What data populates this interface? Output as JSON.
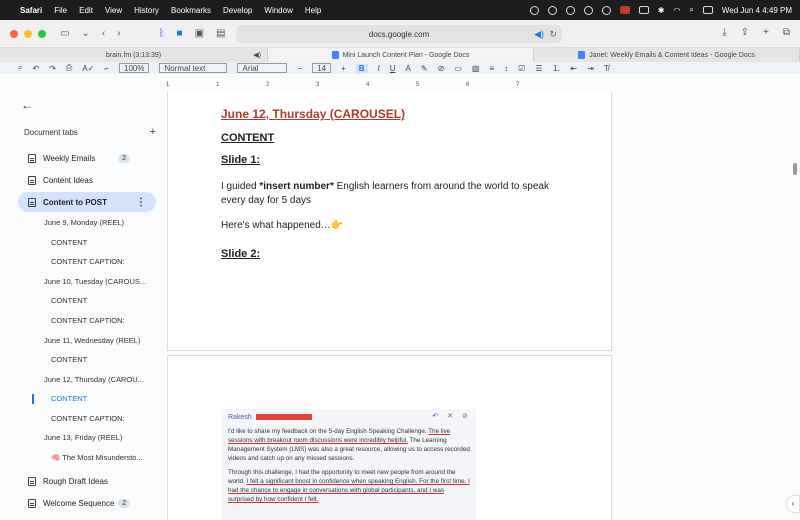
{
  "menubar": {
    "app": "Safari",
    "menus": [
      "File",
      "Edit",
      "View",
      "History",
      "Bookmarks",
      "Develop",
      "Window",
      "Help"
    ],
    "clock": "Wed Jun 4  4:49 PM"
  },
  "browser": {
    "address": "docs.google.com",
    "tabs": [
      {
        "label": "brain.fm (3:13:39)"
      },
      {
        "label": "Mini Launch Content Plan - Google Docs"
      },
      {
        "label": "Janet: Weekly Emails & Content Ideas - Google Docs"
      }
    ]
  },
  "toolbar": {
    "zoom": "100%",
    "style": "Normal text",
    "font": "Arial",
    "font_size": "14"
  },
  "sidebar": {
    "title": "Document tabs",
    "tabs": [
      {
        "label": "Weekly Emails",
        "badge": "2"
      },
      {
        "label": "Content Ideas"
      },
      {
        "label": "Content to POST"
      },
      {
        "label": "Rough Draft Ideas"
      },
      {
        "label": "Welcome Sequence",
        "badge": "2"
      }
    ],
    "outline": [
      "June 9, Monday (REEL)",
      "CONTENT",
      "CONTENT CAPTION:",
      "June 10, Tuesday (CAROUS...",
      "CONTENT",
      "CONTENT CAPTION:",
      "June 11, Wednesday (REEL)",
      "CONTENT",
      "June 12, Thursday (CAROU...",
      "CONTENT",
      "CONTENT CAPTION:",
      "June 13, Friday (REEL)",
      "🧠 The Most Misundersto..."
    ]
  },
  "ruler": {
    "marks": [
      "1",
      "1",
      "2",
      "3",
      "4",
      "5",
      "6",
      "7"
    ]
  },
  "document": {
    "heading": "June 12, Thursday (CAROUSEL)",
    "content_label": "CONTENT",
    "slide1": "Slide 1:",
    "para_prefix": "I guided ",
    "para_bold": "*insert number*",
    "para_suffix": " English learners from around the world to speak every day for 5 days",
    "para2": "Here's what happened…👉",
    "slide2": "Slide 2:"
  },
  "feedback": {
    "name": "Rakesh",
    "p1_a": "I'd like to share my feedback on the 5-day English Speaking Challenge. ",
    "p1_b": "The live sessions with breakout room discussions were incredibly helpful.",
    "p1_c": " The Learning Management System (LMS) was also a great resource, allowing us to access recorded videos and catch up on any missed sessions.",
    "p2_a": "Through this challenge, I had the opportunity to meet new people from around the world. ",
    "p2_b": "I felt a significant boost in confidence when speaking English. For the first time, I had the chance to engage in conversations with global participants, and I was surprised by how confident I felt."
  }
}
